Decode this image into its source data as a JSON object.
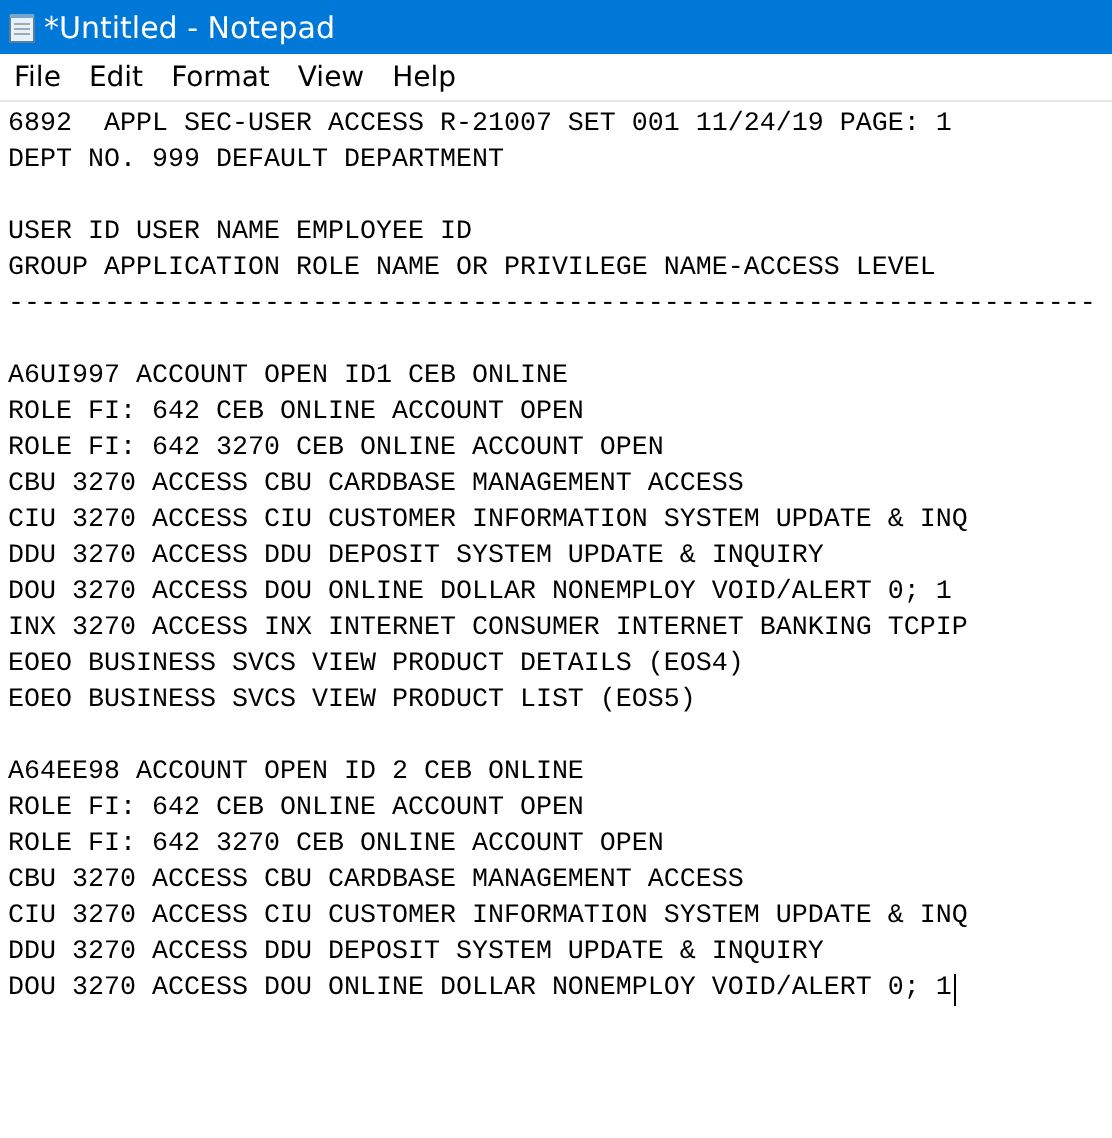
{
  "window": {
    "title": "*Untitled - Notepad"
  },
  "menu": [
    "File",
    "Edit",
    "Format",
    "View",
    "Help"
  ],
  "editor": {
    "caret_at_end": true,
    "paragraphs": [
      [
        "6892  APPL SEC-USER ACCESS R-21007 SET 001 11/24/19 PAGE: 1",
        "DEPT NO. 999 DEFAULT DEPARTMENT"
      ],
      [
        "USER ID USER NAME EMPLOYEE ID",
        "GROUP APPLICATION ROLE NAME OR PRIVILEGE NAME-ACCESS LEVEL",
        "--------------------------------------------------------------------"
      ],
      [
        "A6UI997 ACCOUNT OPEN ID1 CEB ONLINE",
        "ROLE FI: 642 CEB ONLINE ACCOUNT OPEN",
        "ROLE FI: 642 3270 CEB ONLINE ACCOUNT OPEN",
        "CBU 3270 ACCESS CBU CARDBASE MANAGEMENT ACCESS",
        "CIU 3270 ACCESS CIU CUSTOMER INFORMATION SYSTEM UPDATE & INQ",
        "DDU 3270 ACCESS DDU DEPOSIT SYSTEM UPDATE & INQUIRY",
        "DOU 3270 ACCESS DOU ONLINE DOLLAR NONEMPLOY VOID/ALERT 0; 1",
        "INX 3270 ACCESS INX INTERNET CONSUMER INTERNET BANKING TCPIP",
        "EOEO BUSINESS SVCS VIEW PRODUCT DETAILS (EOS4)",
        "EOEO BUSINESS SVCS VIEW PRODUCT LIST (EOS5)"
      ],
      [
        "A64EE98 ACCOUNT OPEN ID 2 CEB ONLINE",
        "ROLE FI: 642 CEB ONLINE ACCOUNT OPEN",
        "ROLE FI: 642 3270 CEB ONLINE ACCOUNT OPEN",
        "CBU 3270 ACCESS CBU CARDBASE MANAGEMENT ACCESS",
        "CIU 3270 ACCESS CIU CUSTOMER INFORMATION SYSTEM UPDATE & INQ",
        "DDU 3270 ACCESS DDU DEPOSIT SYSTEM UPDATE & INQUIRY",
        "DOU 3270 ACCESS DOU ONLINE DOLLAR NONEMPLOY VOID/ALERT 0; 1"
      ]
    ]
  }
}
